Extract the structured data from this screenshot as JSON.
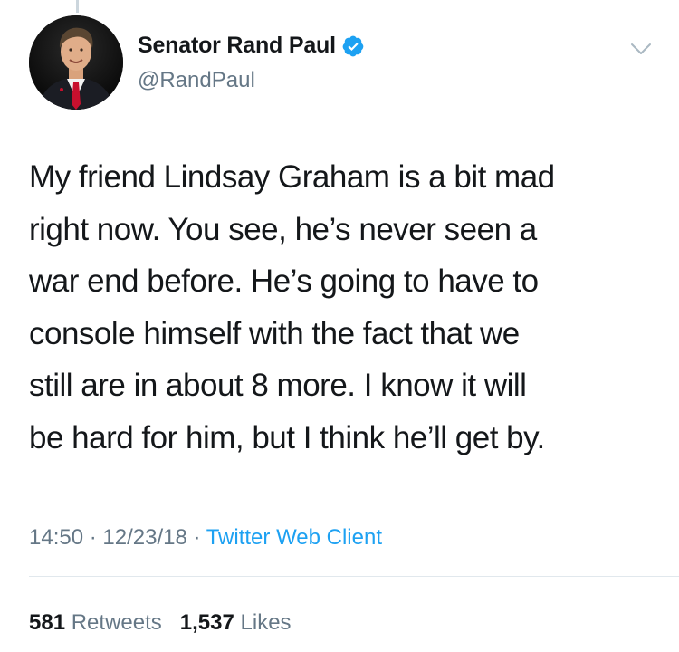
{
  "author": {
    "display_name": "Senator Rand Paul",
    "handle": "@RandPaul",
    "verified": true,
    "avatar_icon": "profile-photo"
  },
  "tweet": {
    "lines": [
      "My friend Lindsay Graham is a bit mad",
      "right now. You see, he’s never seen a",
      "war end before. He’s going to have to",
      "console himself with the fact that we",
      "still are in about 8 more. I know it will",
      "be hard for him, but I think he’ll get by."
    ]
  },
  "meta": {
    "time": "14:50",
    "separator": " · ",
    "date": "12/23/18",
    "client": "Twitter Web Client"
  },
  "stats": {
    "retweets_count": "581",
    "retweets_label": "Retweets",
    "likes_count": "1,537",
    "likes_label": "Likes"
  },
  "colors": {
    "link": "#1da1f2",
    "secondary_text": "#657786",
    "primary_text": "#14171a",
    "verified_badge": "#1da1f2"
  },
  "icons": {
    "verified": "verified-badge-icon",
    "menu": "chevron-down-icon"
  }
}
